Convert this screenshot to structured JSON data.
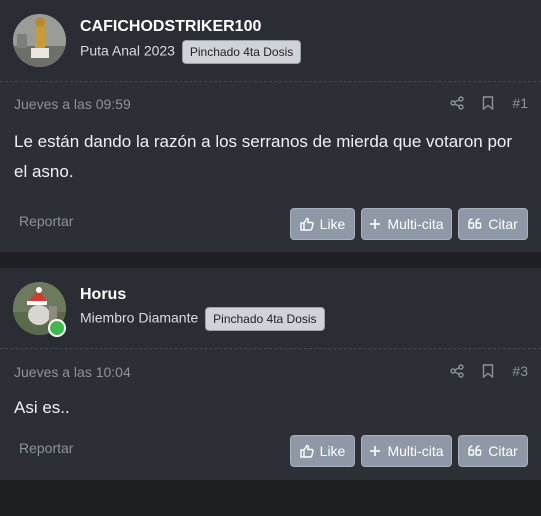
{
  "posts": [
    {
      "username": "CAFICHODSTRIKER100",
      "user_title": "Puta Anal 2023",
      "badge": "Pinchado 4ta Dosis",
      "date": "Jueves a las 09:59",
      "number": "#1",
      "content": "Le están dando la razón a los serranos de mierda que votaron por el asno.",
      "report": "Reportar",
      "like": "Like",
      "multi": "Multi-cita",
      "cite": "Citar"
    },
    {
      "username": "Horus",
      "user_title": "Miembro Diamante",
      "badge": "Pinchado 4ta Dosis",
      "date": "Jueves a las 10:04",
      "number": "#3",
      "content": "Asi es..",
      "report": "Reportar",
      "like": "Like",
      "multi": "Multi-cita",
      "cite": "Citar"
    }
  ],
  "colors": {
    "background": "#1d1f23",
    "post_bg": "#2c2f35",
    "button_bg": "#8e98a6",
    "online": "#3fb950"
  }
}
